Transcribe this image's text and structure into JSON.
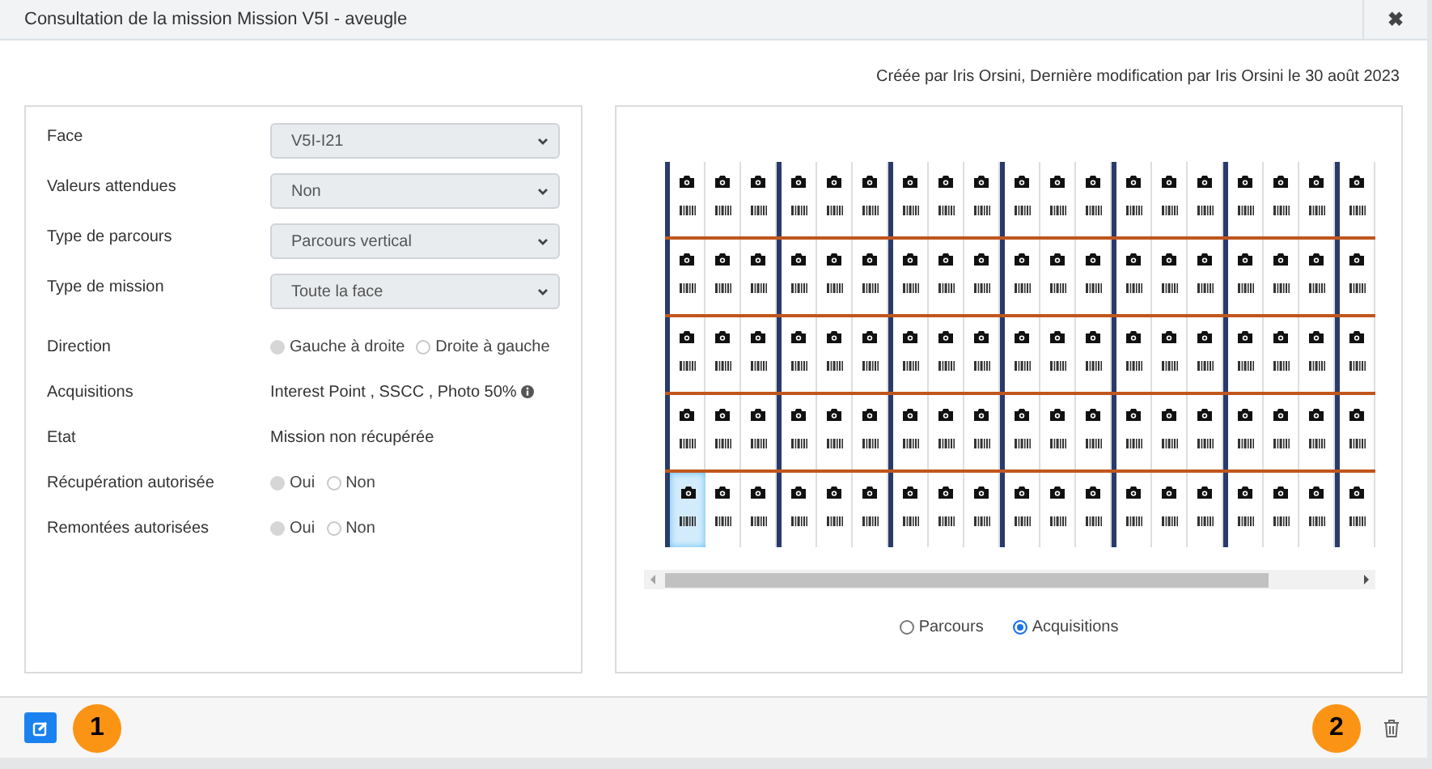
{
  "window": {
    "title": "Consultation de la mission Mission V5I - aveugle",
    "close": "✖"
  },
  "meta": "Créée par Iris Orsini, Dernière modification par Iris Orsini le 30 août 2023",
  "form": [
    {
      "kind": "select",
      "label": "Face",
      "value": "V5I-I21"
    },
    {
      "kind": "select",
      "label": "Valeurs attendues",
      "value": "Non"
    },
    {
      "kind": "select",
      "label": "Type de parcours",
      "value": "Parcours vertical"
    },
    {
      "kind": "select",
      "label": "Type de mission",
      "value": "Toute la face"
    },
    {
      "kind": "radio",
      "label": "Direction",
      "options": [
        {
          "label": "Gauche à droite",
          "selected": true
        },
        {
          "label": "Droite à gauche",
          "selected": false
        }
      ]
    },
    {
      "kind": "text",
      "label": "Acquisitions",
      "value": "Interest Point , SSCC , Photo 50%",
      "info": true
    },
    {
      "kind": "text",
      "label": "Etat",
      "value": "Mission non récupérée"
    },
    {
      "kind": "radio",
      "label": "Récupération autorisée",
      "options": [
        {
          "label": "Oui",
          "selected": true
        },
        {
          "label": "Non",
          "selected": false
        }
      ]
    },
    {
      "kind": "radio",
      "label": "Remontées autorisées",
      "options": [
        {
          "label": "Oui",
          "selected": true
        },
        {
          "label": "Non",
          "selected": false
        }
      ]
    }
  ],
  "grid": {
    "rows": [
      {
        "cells": [
          {
            "selected": false
          },
          {
            "selected": false
          },
          {
            "selected": false
          },
          {
            "selected": false
          },
          {
            "selected": false
          },
          {
            "selected": false
          },
          {
            "selected": false
          },
          {
            "selected": false
          },
          {
            "selected": false
          },
          {
            "selected": false
          },
          {
            "selected": false
          },
          {
            "selected": false
          },
          {
            "selected": false
          },
          {
            "selected": false
          },
          {
            "selected": false
          },
          {
            "selected": false
          },
          {
            "selected": false
          },
          {
            "selected": false
          },
          {
            "selected": false
          }
        ]
      },
      {
        "cells": [
          {
            "selected": false
          },
          {
            "selected": false
          },
          {
            "selected": false
          },
          {
            "selected": false
          },
          {
            "selected": false
          },
          {
            "selected": false
          },
          {
            "selected": false
          },
          {
            "selected": false
          },
          {
            "selected": false
          },
          {
            "selected": false
          },
          {
            "selected": false
          },
          {
            "selected": false
          },
          {
            "selected": false
          },
          {
            "selected": false
          },
          {
            "selected": false
          },
          {
            "selected": false
          },
          {
            "selected": false
          },
          {
            "selected": false
          },
          {
            "selected": false
          }
        ]
      },
      {
        "cells": [
          {
            "selected": false
          },
          {
            "selected": false
          },
          {
            "selected": false
          },
          {
            "selected": false
          },
          {
            "selected": false
          },
          {
            "selected": false
          },
          {
            "selected": false
          },
          {
            "selected": false
          },
          {
            "selected": false
          },
          {
            "selected": false
          },
          {
            "selected": false
          },
          {
            "selected": false
          },
          {
            "selected": false
          },
          {
            "selected": false
          },
          {
            "selected": false
          },
          {
            "selected": false
          },
          {
            "selected": false
          },
          {
            "selected": false
          },
          {
            "selected": false
          }
        ]
      },
      {
        "cells": [
          {
            "selected": false
          },
          {
            "selected": false
          },
          {
            "selected": false
          },
          {
            "selected": false
          },
          {
            "selected": false
          },
          {
            "selected": false
          },
          {
            "selected": false
          },
          {
            "selected": false
          },
          {
            "selected": false
          },
          {
            "selected": false
          },
          {
            "selected": false
          },
          {
            "selected": false
          },
          {
            "selected": false
          },
          {
            "selected": false
          },
          {
            "selected": false
          },
          {
            "selected": false
          },
          {
            "selected": false
          },
          {
            "selected": false
          },
          {
            "selected": false
          }
        ]
      },
      {
        "cells": [
          {
            "selected": true
          },
          {
            "selected": false
          },
          {
            "selected": false
          },
          {
            "selected": false
          },
          {
            "selected": false
          },
          {
            "selected": false
          },
          {
            "selected": false
          },
          {
            "selected": false
          },
          {
            "selected": false
          },
          {
            "selected": false
          },
          {
            "selected": false
          },
          {
            "selected": false
          },
          {
            "selected": false
          },
          {
            "selected": false
          },
          {
            "selected": false
          },
          {
            "selected": false
          },
          {
            "selected": false
          },
          {
            "selected": false
          },
          {
            "selected": false
          }
        ]
      }
    ]
  },
  "view_options": [
    {
      "label": "Parcours",
      "selected": false
    },
    {
      "label": "Acquisitions",
      "selected": true
    }
  ],
  "badges": [
    "1",
    "2"
  ]
}
